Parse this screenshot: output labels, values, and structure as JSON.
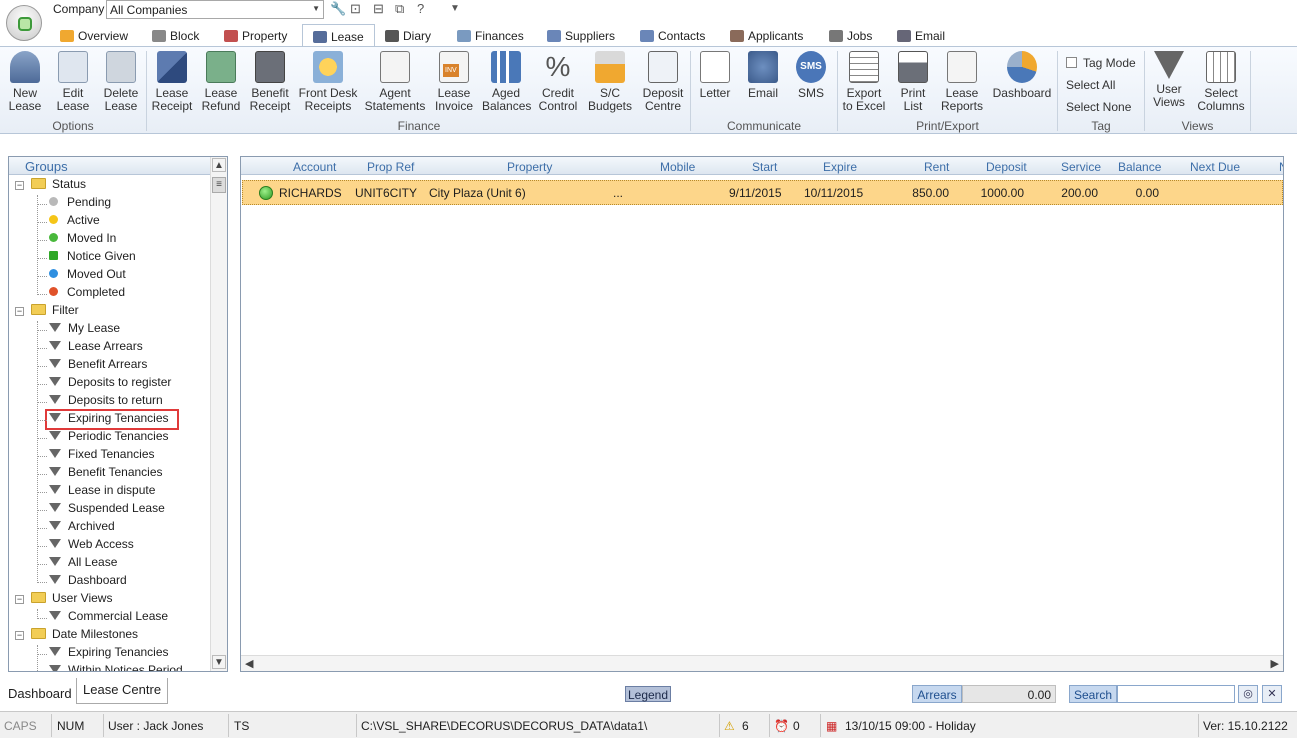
{
  "app": {
    "company_label": "Company",
    "company_value": "All Companies"
  },
  "tabs": [
    {
      "label": "Overview"
    },
    {
      "label": "Block"
    },
    {
      "label": "Property"
    },
    {
      "label": "Lease"
    },
    {
      "label": "Diary"
    },
    {
      "label": "Finances"
    },
    {
      "label": "Suppliers"
    },
    {
      "label": "Contacts"
    },
    {
      "label": "Applicants"
    },
    {
      "label": "Jobs"
    },
    {
      "label": "Email"
    }
  ],
  "ribbon": {
    "new_lease": "New Lease",
    "edit_lease": "Edit Lease",
    "delete_lease": "Delete Lease",
    "options": "Options",
    "lease_receipt": "Lease Receipt",
    "lease_refund": "Lease Refund",
    "benefit_receipt": "Benefit Receipt",
    "front_desk_receipts": "Front Desk Receipts",
    "agent_statements": "Agent Statements",
    "lease_invoice": "Lease Invoice",
    "aged_balances": "Aged Balances",
    "credit_control": "Credit Control",
    "sc_budgets": "S/C Budgets",
    "deposit_centre": "Deposit Centre",
    "finance": "Finance",
    "letter": "Letter",
    "email": "Email",
    "sms": "SMS",
    "communicate": "Communicate",
    "export_excel": "Export to Excel",
    "print_list": "Print List",
    "lease_reports": "Lease Reports",
    "dashboard": "Dashboard",
    "print_export": "Print/Export",
    "tag_mode": "Tag Mode",
    "select_all": "Select All",
    "select_none": "Select None",
    "tag": "Tag",
    "user_views": "User Views",
    "select_columns": "Select Columns",
    "views": "Views",
    "inv_badge": "INV",
    "sms_badge": "SMS"
  },
  "groups": {
    "header": "Groups",
    "status": {
      "label": "Status",
      "items": [
        "Pending",
        "Active",
        "Moved In",
        "Notice Given",
        "Moved Out",
        "Completed"
      ],
      "colors": [
        "#b9b9b9",
        "#f5c518",
        "#49b83c",
        "#2fa827",
        "#2f8fe0",
        "#e0522a"
      ]
    },
    "filter": {
      "label": "Filter",
      "items": [
        "My Lease",
        "Lease Arrears",
        "Benefit Arrears",
        "Deposits to register",
        "Deposits to return",
        "Expiring Tenancies",
        "Periodic Tenancies",
        "Fixed Tenancies",
        "Benefit Tenancies",
        "Lease in dispute",
        "Suspended Lease",
        "Archived",
        "Web Access",
        "All Lease",
        "Dashboard"
      ]
    },
    "user_views": {
      "label": "User Views",
      "items": [
        "Commercial Lease"
      ]
    },
    "date_milestones": {
      "label": "Date Milestones",
      "items": [
        "Expiring Tenancies",
        "Within Notices Period"
      ]
    }
  },
  "grid": {
    "columns": [
      "Account",
      "Prop Ref",
      "Property",
      "Mobile",
      "Start",
      "Expire",
      "Rent",
      "Deposit",
      "Service",
      "Balance",
      "Next Due",
      "N"
    ],
    "rows": [
      {
        "account": "RICHARDS",
        "prop_ref": "UNIT6CITY",
        "property": "City Plaza (Unit 6)",
        "mobile": "...",
        "start": "9/11/2015",
        "expire": "10/11/2015",
        "rent": "850.00",
        "deposit": "1000.00",
        "service": "200.00",
        "balance": "0.00",
        "next_due": ""
      }
    ]
  },
  "bottom": {
    "tab_dashboard": "Dashboard",
    "tab_lease_centre": "Lease Centre",
    "legend": "Legend",
    "arrears_label": "Arrears",
    "arrears_value": "0.00",
    "search_label": "Search",
    "search_value": ""
  },
  "status": {
    "caps": "CAPS",
    "num": "NUM",
    "user": "User : Jack Jones",
    "ts": "TS",
    "path": "C:\\VSL_SHARE\\DECORUS\\DECORUS_DATA\\data1\\",
    "warnings": "6",
    "alarms": "0",
    "calendar": "13/10/15 09:00 - Holiday",
    "version": "Ver: 15.10.2122"
  }
}
